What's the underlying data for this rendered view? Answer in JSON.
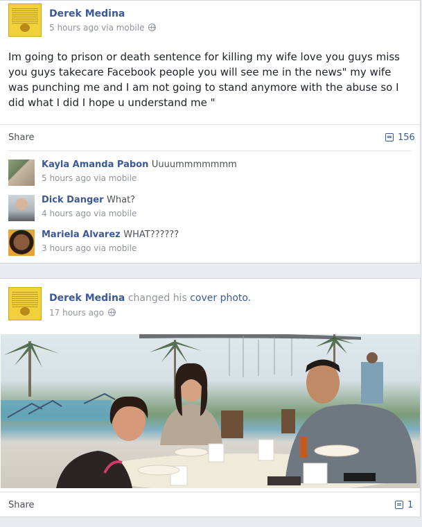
{
  "post1": {
    "author": "Derek Medina",
    "meta": "5 hours ago via mobile",
    "text": "Im going to prison or death sentence for killing my wife love you guys miss you guys takecare Facebook people you will see me in the news\" my wife was punching me and I am not going to stand anymore with the abuse so I did what I did I hope u understand me \"",
    "share_label": "Share",
    "comment_count": "156",
    "comments": [
      {
        "name": "Kayla Amanda Pabon",
        "text": "Uuuummmmmmm",
        "meta": "5 hours ago via mobile"
      },
      {
        "name": "Dick Danger",
        "text": "What?",
        "meta": "4 hours ago via mobile"
      },
      {
        "name": "Mariela Alvarez",
        "text": "WHAT??????",
        "meta": "3 hours ago via mobile"
      }
    ]
  },
  "post2": {
    "author": "Derek Medina",
    "action": "changed his",
    "object": "cover photo.",
    "meta": "17 hours ago",
    "share_label": "Share",
    "comment_count": "1"
  },
  "icons": {
    "privacy": "globe-icon",
    "comments": "comment-icon"
  },
  "colors": {
    "link": "#3b5998",
    "meta": "#90949c",
    "background": "#e9eaed"
  }
}
